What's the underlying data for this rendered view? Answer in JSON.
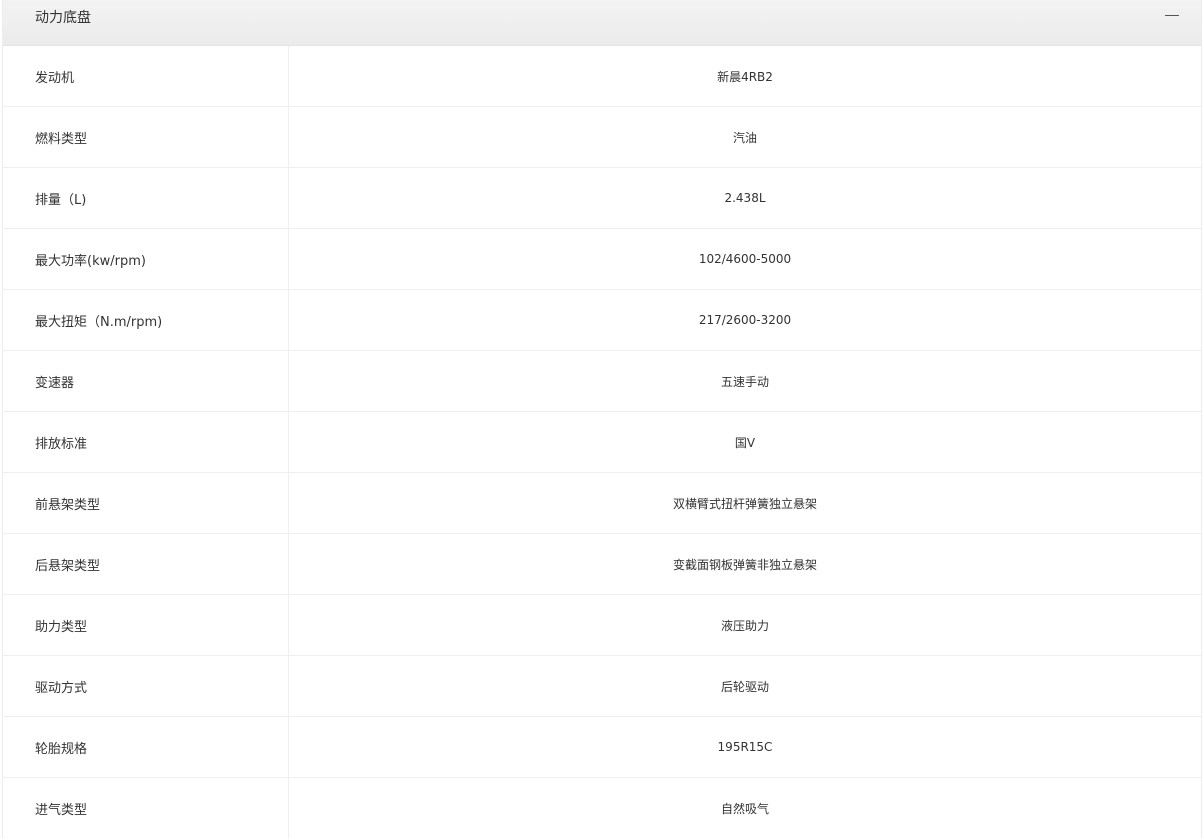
{
  "section": {
    "title": "动力底盘",
    "collapse_icon": "minus-icon"
  },
  "specs": [
    {
      "label": "发动机",
      "value": "新晨4RB2"
    },
    {
      "label": "燃料类型",
      "value": "汽油"
    },
    {
      "label": "排量（L)",
      "value": "2.438L"
    },
    {
      "label": "最大功率(kw/rpm)",
      "value": "102/4600-5000"
    },
    {
      "label": "最大扭矩（N.m/rpm)",
      "value": "217/2600-3200"
    },
    {
      "label": "变速器",
      "value": "五速手动"
    },
    {
      "label": "排放标准",
      "value": "国V"
    },
    {
      "label": "前悬架类型",
      "value": "双横臂式扭杆弹簧独立悬架"
    },
    {
      "label": "后悬架类型",
      "value": "变截面钢板弹簧非独立悬架"
    },
    {
      "label": "助力类型",
      "value": "液压助力"
    },
    {
      "label": "驱动方式",
      "value": "后轮驱动"
    },
    {
      "label": "轮胎规格",
      "value": "195R15C"
    },
    {
      "label": "进气类型",
      "value": "自然吸气"
    }
  ]
}
